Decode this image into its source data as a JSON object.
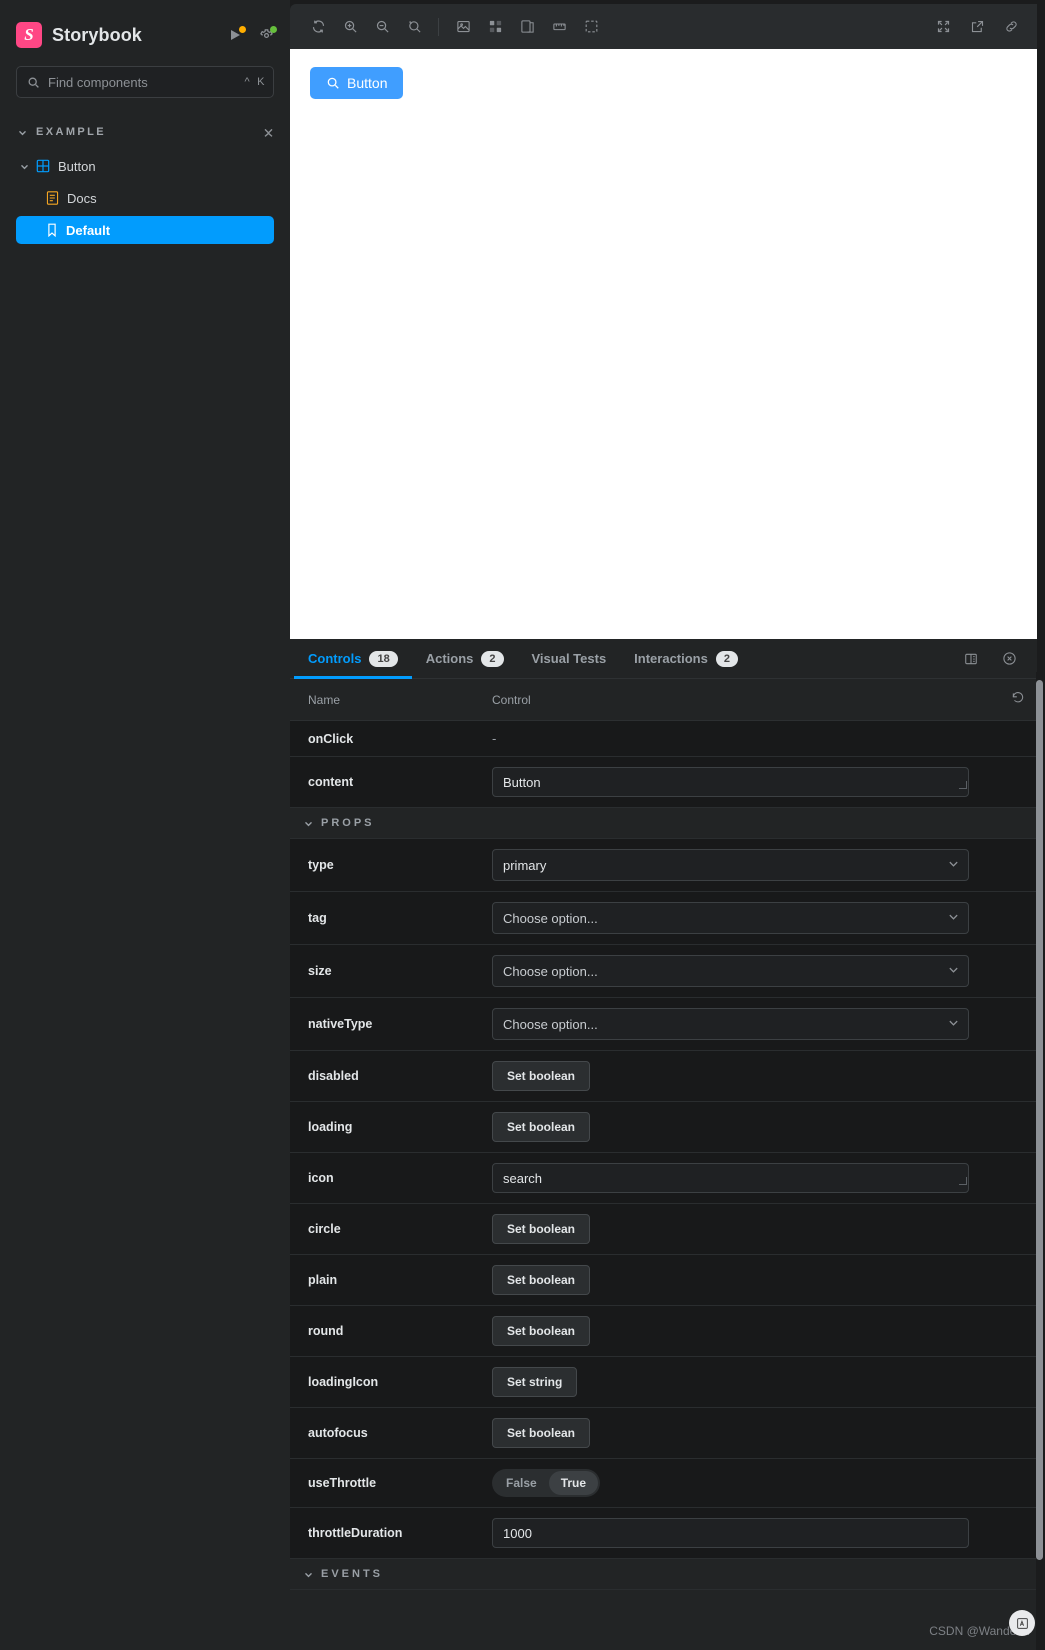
{
  "sidebar": {
    "brand": "Storybook",
    "logo_letter": "S",
    "logo_color": "#ff4785",
    "search": {
      "placeholder": "Find components",
      "value": "",
      "shortcut_mod": "^",
      "shortcut_key": "K"
    },
    "group": {
      "label": "EXAMPLE"
    },
    "component": {
      "label": "Button"
    },
    "items": [
      {
        "label": "Docs",
        "icon": "docs-icon",
        "selected": false
      },
      {
        "label": "Default",
        "icon": "bookmark-icon",
        "selected": true
      }
    ],
    "selected_color": "#029cfd"
  },
  "toolbar": {
    "left_tools": [
      {
        "name": "remount-icon",
        "title": "Remount component"
      },
      {
        "name": "zoom-in-icon",
        "title": "Zoom in"
      },
      {
        "name": "zoom-out-icon",
        "title": "Zoom out"
      },
      {
        "name": "zoom-reset-icon",
        "title": "Reset zoom"
      }
    ],
    "addon_tools": [
      {
        "name": "backgrounds-icon",
        "title": "Change background"
      },
      {
        "name": "grid-icon",
        "title": "Apply a grid to the preview"
      },
      {
        "name": "viewport-icon",
        "title": "Change the size of the preview"
      },
      {
        "name": "measure-icon",
        "title": "Enable measure"
      },
      {
        "name": "outline-icon",
        "title": "Apply outlines to the preview"
      }
    ],
    "right_tools": [
      {
        "name": "fullscreen-icon",
        "title": "Go full screen"
      },
      {
        "name": "open-new-tab-icon",
        "title": "Open canvas in new tab"
      },
      {
        "name": "copy-link-icon",
        "title": "Copy canvas link"
      }
    ]
  },
  "preview": {
    "button": {
      "label": "Button",
      "icon": "search-icon",
      "color": "#409eff"
    },
    "background": "#ffffff"
  },
  "panel": {
    "tabs": [
      {
        "label": "Controls",
        "badge": "18",
        "active": true
      },
      {
        "label": "Actions",
        "badge": "2",
        "active": false
      },
      {
        "label": "Visual Tests",
        "badge": "",
        "active": false
      },
      {
        "label": "Interactions",
        "badge": "2",
        "active": false
      }
    ],
    "right_icons": [
      {
        "name": "panel-position-icon",
        "title": "Change addon orientation"
      },
      {
        "name": "close-panel-icon",
        "title": "Hide addons"
      }
    ],
    "table": {
      "headers": {
        "name": "Name",
        "control": "Control",
        "reset": "reset-controls-icon"
      },
      "rows": [
        {
          "kind": "row",
          "name": "onClick",
          "control": "dash",
          "value": "-"
        },
        {
          "kind": "row",
          "name": "content",
          "control": "text",
          "value": "Button"
        },
        {
          "kind": "section",
          "name": "PROPS"
        },
        {
          "kind": "row",
          "name": "type",
          "control": "select",
          "value": "primary"
        },
        {
          "kind": "row",
          "name": "tag",
          "control": "select",
          "value": "Choose option..."
        },
        {
          "kind": "row",
          "name": "size",
          "control": "select",
          "value": "Choose option..."
        },
        {
          "kind": "row",
          "name": "nativeType",
          "control": "select",
          "value": "Choose option..."
        },
        {
          "kind": "row",
          "name": "disabled",
          "control": "button",
          "value": "Set boolean"
        },
        {
          "kind": "row",
          "name": "loading",
          "control": "button",
          "value": "Set boolean"
        },
        {
          "kind": "row",
          "name": "icon",
          "control": "text",
          "value": "search"
        },
        {
          "kind": "row",
          "name": "circle",
          "control": "button",
          "value": "Set boolean"
        },
        {
          "kind": "row",
          "name": "plain",
          "control": "button",
          "value": "Set boolean"
        },
        {
          "kind": "row",
          "name": "round",
          "control": "button",
          "value": "Set boolean"
        },
        {
          "kind": "row",
          "name": "loadingIcon",
          "control": "button",
          "value": "Set string"
        },
        {
          "kind": "row",
          "name": "autofocus",
          "control": "button",
          "value": "Set boolean"
        },
        {
          "kind": "row",
          "name": "useThrottle",
          "control": "toggle",
          "value": "True",
          "options": [
            "False",
            "True"
          ]
        },
        {
          "kind": "row",
          "name": "throttleDuration",
          "control": "text",
          "value": "1000"
        },
        {
          "kind": "section",
          "name": "EVENTS"
        }
      ]
    }
  },
  "watermark": {
    "text": "CSDN @Wanderer"
  }
}
